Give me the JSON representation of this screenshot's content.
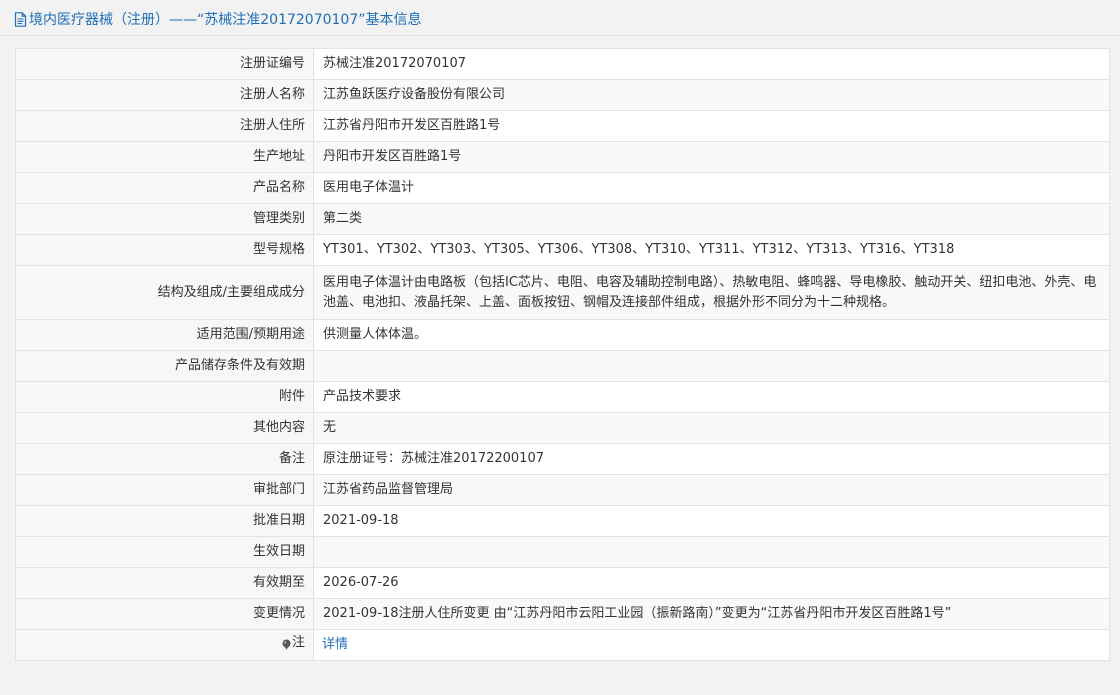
{
  "header": {
    "title": "境内医疗器械（注册）——“苏械注准20172070107”基本信息"
  },
  "colors": {
    "accent": "#1f6fb6",
    "label_bg": "#f7f7f7",
    "border": "#e3e3e3"
  },
  "rows": [
    {
      "label": "注册证编号",
      "value": "苏械注准20172070107"
    },
    {
      "label": "注册人名称",
      "value": "江苏鱼跃医疗设备股份有限公司"
    },
    {
      "label": "注册人住所",
      "value": "江苏省丹阳市开发区百胜路1号"
    },
    {
      "label": "生产地址",
      "value": "丹阳市开发区百胜路1号"
    },
    {
      "label": "产品名称",
      "value": "医用电子体温计"
    },
    {
      "label": "管理类别",
      "value": "第二类"
    },
    {
      "label": "型号规格",
      "value": "YT301、YT302、YT303、YT305、YT306、YT308、YT310、YT311、YT312、YT313、YT316、YT318"
    },
    {
      "label": "结构及组成/主要组成成分",
      "value": "医用电子体温计由电路板（包括IC芯片、电阻、电容及辅助控制电路）、热敏电阻、蜂鸣器、导电橡胶、触动开关、纽扣电池、外壳、电池盖、电池扣、液晶托架、上盖、面板按钮、钢帽及连接部件组成，根据外形不同分为十二种规格。"
    },
    {
      "label": "适用范围/预期用途",
      "value": "供测量人体体温。"
    },
    {
      "label": "产品储存条件及有效期",
      "value": ""
    },
    {
      "label": "附件",
      "value": "产品技术要求"
    },
    {
      "label": "其他内容",
      "value": "无"
    },
    {
      "label": "备注",
      "value": "原注册证号：苏械注准20172200107"
    },
    {
      "label": "审批部门",
      "value": "江苏省药品监督管理局"
    },
    {
      "label": "批准日期",
      "value": "2021-09-18"
    },
    {
      "label": "生效日期",
      "value": ""
    },
    {
      "label": "有效期至",
      "value": "2026-07-26"
    },
    {
      "label": "变更情况",
      "value": "2021-09-18注册人住所变更 由“江苏丹阳市云阳工业园（振新路南）”变更为“江苏省丹阳市开发区百胜路1号”"
    }
  ],
  "note_row": {
    "label": "注",
    "link_label": "详情",
    "icon": "pin-icon"
  }
}
